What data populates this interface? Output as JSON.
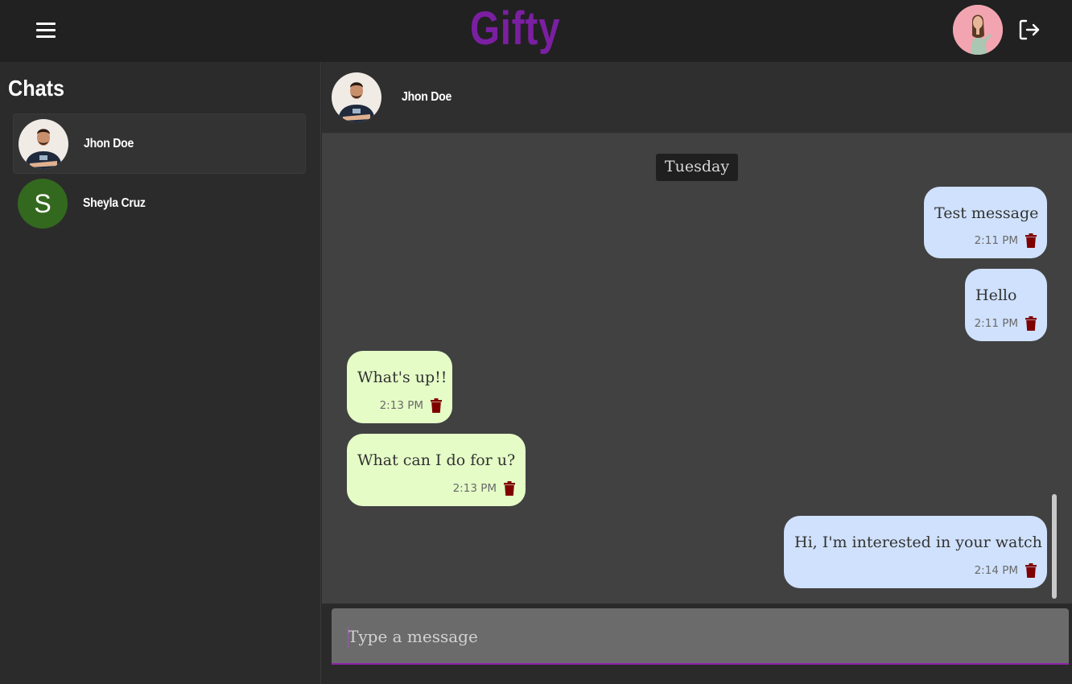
{
  "app": {
    "brand": "Gifty",
    "brand_color": "#7b1fa2",
    "menu_icon": "hamburger-menu-icon",
    "logout_icon": "logout-icon",
    "user_avatar": "user-avatar-photo"
  },
  "sidebar": {
    "title": "Chats",
    "chats": [
      {
        "name": "Jhon Doe",
        "avatar": "photo",
        "active": true
      },
      {
        "name": "Sheyla Cruz",
        "avatar_letter": "S",
        "avatar_color": "#33691e",
        "active": false
      }
    ]
  },
  "conversation": {
    "contact_name": "Jhon Doe",
    "day_label": "Tuesday",
    "messages": [
      {
        "direction": "out",
        "text": "Test message",
        "time": "2:11 PM"
      },
      {
        "direction": "out",
        "text": "Hello",
        "time": "2:11 PM"
      },
      {
        "direction": "in",
        "text": "What's up!!",
        "time": "2:13 PM"
      },
      {
        "direction": "in",
        "text": "What can I do for u?",
        "time": "2:13 PM"
      },
      {
        "direction": "out",
        "text": "Hi, I'm interested in your watch",
        "time": "2:14 PM"
      }
    ],
    "outgoing_color": "#cfe1fc",
    "incoming_color": "#e5fcc7",
    "delete_icon": "trash-icon",
    "delete_color": "#7f0000"
  },
  "composer": {
    "placeholder": "Type a message",
    "value": ""
  }
}
